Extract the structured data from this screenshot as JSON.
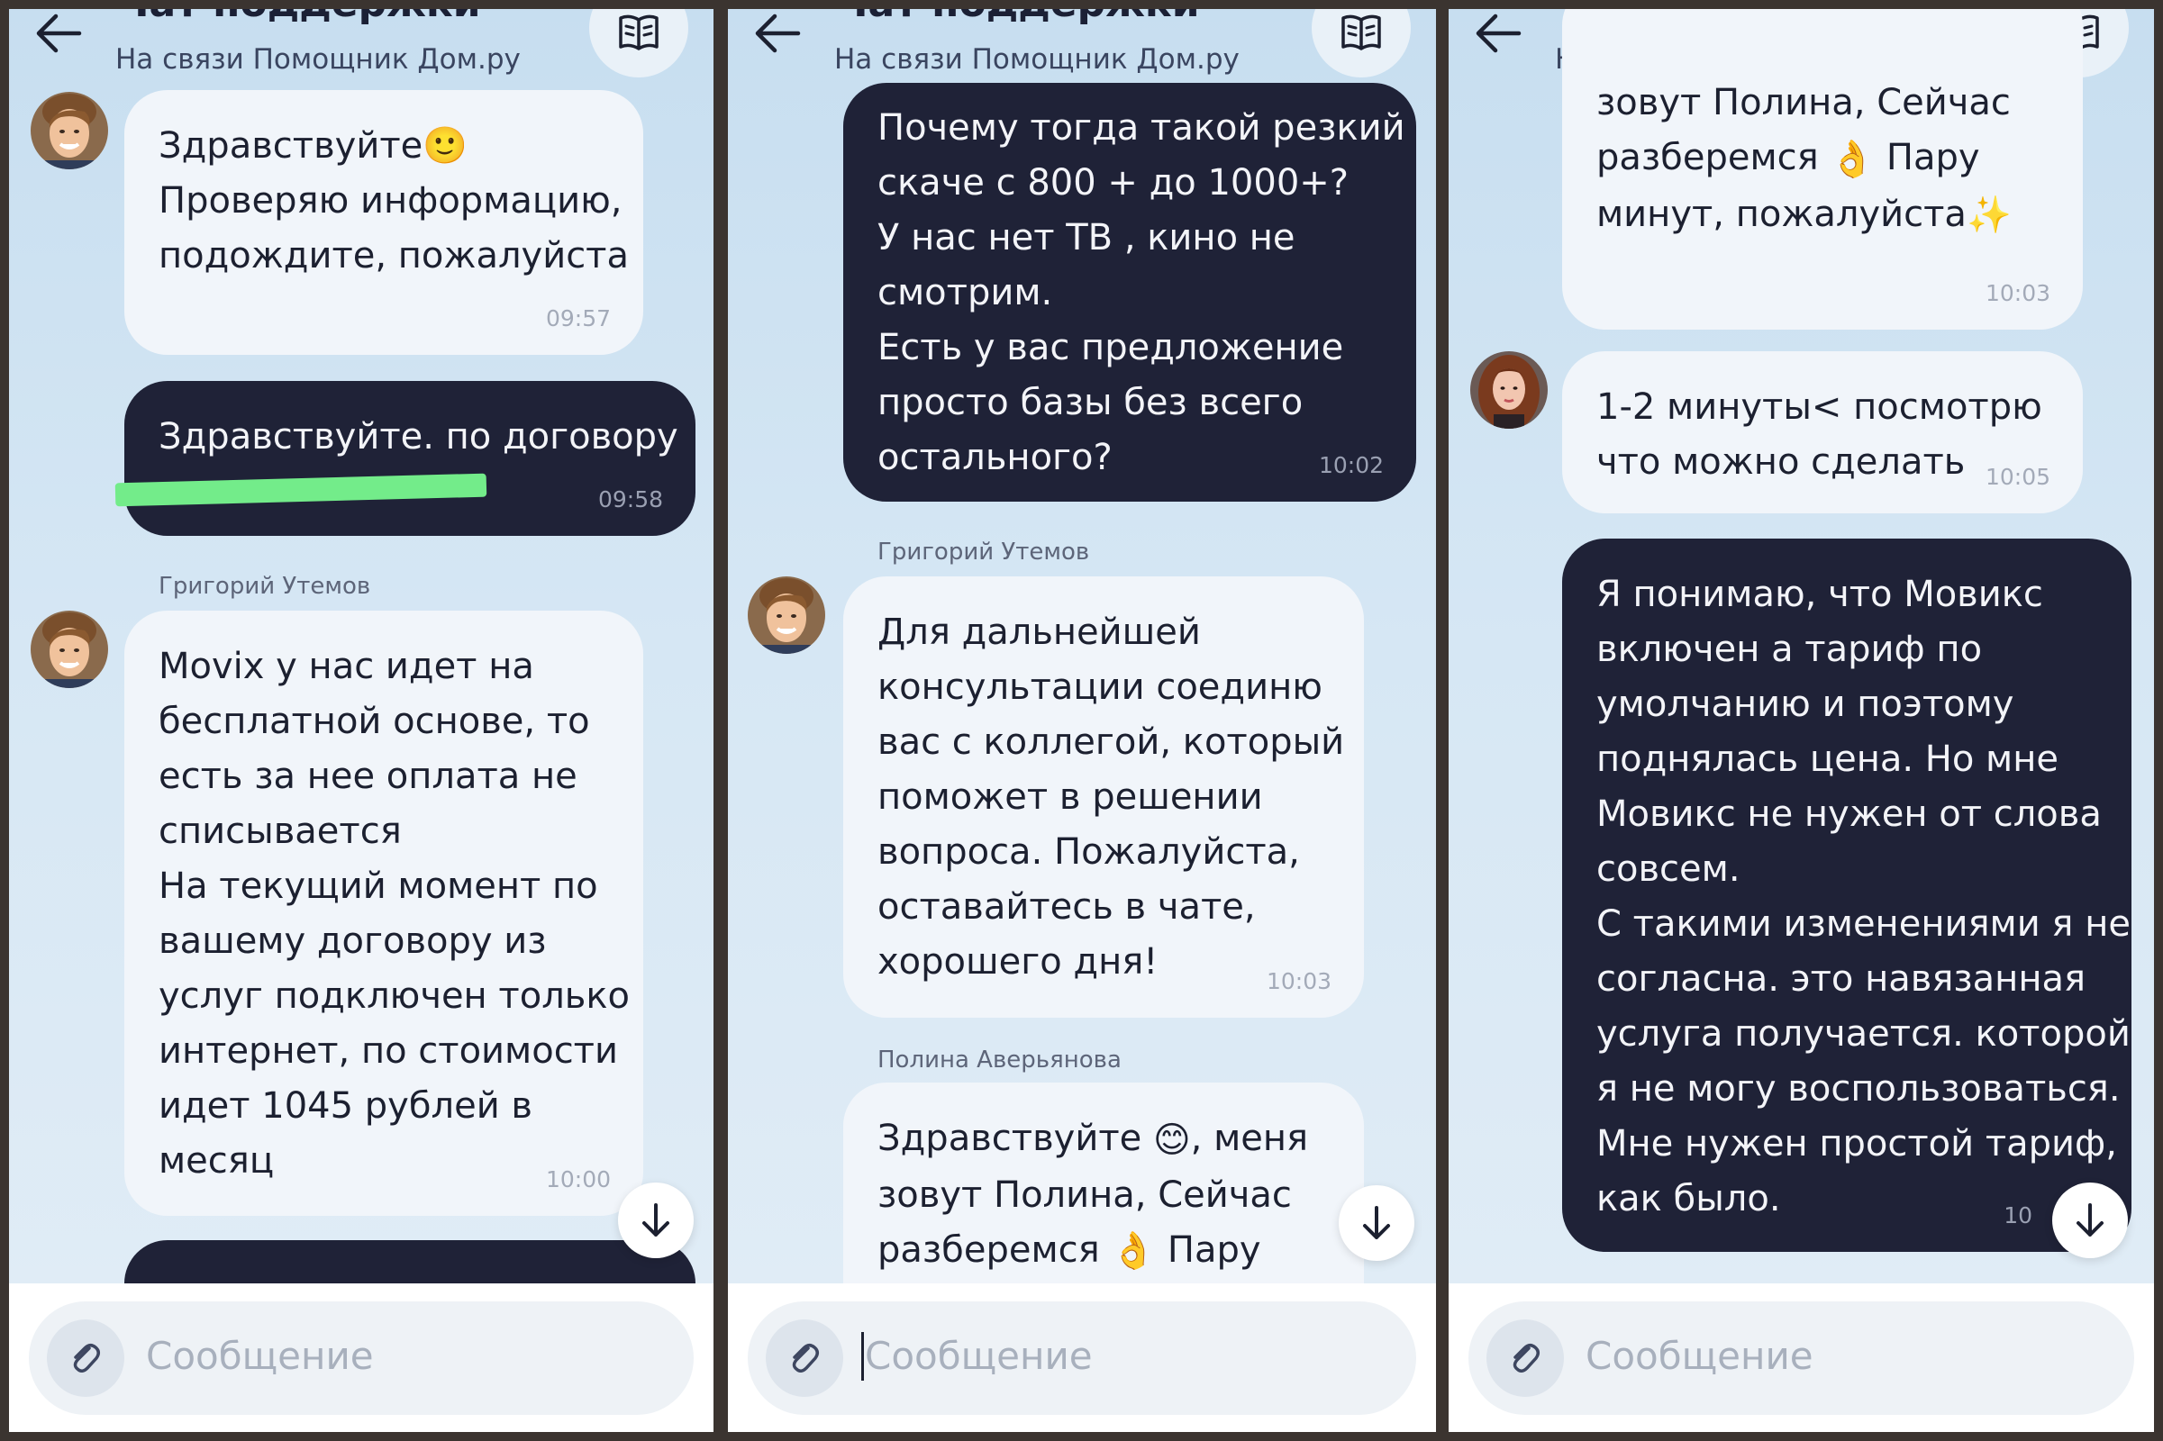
{
  "chat": {
    "title": "Чат поддержки",
    "subtitle": "На связи Помощник Дом.ру",
    "input_placeholder": "Сообщение"
  },
  "colors": {
    "incoming_bubble": "#f1f5fa",
    "outgoing_bubble": "#1f2237",
    "background": "#d6e7f4",
    "redaction_marker": "#73ec8a"
  },
  "icons": {
    "back": "arrow-left-icon",
    "manual": "book-icon",
    "scroll_down": "arrow-down-icon",
    "attach": "paperclip-icon"
  },
  "panel1": {
    "msg1": {
      "line1": "Здравствуйте🙂",
      "line2": "Проверяю информацию,",
      "line3": "подождите, пожалуйста",
      "time": "09:57"
    },
    "msg2": {
      "line1": "Здравствуйте. по договору",
      "time": "09:58"
    },
    "sender": "Григорий Утемов",
    "msg3": {
      "lines": [
        "Movix у нас идет на",
        "бесплатной основе, то",
        "есть за нее оплата не",
        "списывается",
        "На текущий момент по",
        "вашему договору из",
        "услуг подключен только",
        "интернет, по стоимости",
        "идет 1045 рублей в",
        "месяц"
      ],
      "time": "10:00"
    }
  },
  "panel2": {
    "msg1": {
      "lines": [
        "Почему тогда такой резкий",
        "скаче с 800 + до 1000+?",
        "У нас нет ТВ , кино не",
        "смотрим.",
        "Есть у вас предложение",
        "просто базы без всего",
        "остального?"
      ],
      "time": "10:02"
    },
    "sender1": "Григорий Утемов",
    "msg2": {
      "lines": [
        "Для дальнейшей",
        "консультации соединю",
        "вас с коллегой, который",
        "поможет в решении",
        "вопроса. Пожалуйста,",
        "оставайтесь в чате,",
        "хорошего дня!"
      ],
      "time": "10:03"
    },
    "sender2": "Полина Аверьянова",
    "msg3": {
      "line1_text": "Здравствуйте",
      "line1_emoji": "😊",
      "line1_tail": ", меня",
      "line2": "зовут Полина, Сейчас",
      "line3_text": "разберемся",
      "line3_emoji": "👌",
      "line3_tail": " Пару"
    }
  },
  "panel3": {
    "msg1": {
      "line1": "зовут Полина, Сейчас",
      "line2_text": "разберемся",
      "line2_emoji": "👌",
      "line2_tail": " Пару",
      "line3_text": "минут, пожалуйста",
      "line3_emoji": "✨",
      "time": "10:03"
    },
    "msg2": {
      "line1": "1-2 минуты< посмотрю",
      "line2": "что можно сделать",
      "time": "10:05"
    },
    "msg3": {
      "lines": [
        "Я понимаю, что Мовикс",
        "включен а тариф по",
        "умолчанию и поэтому",
        "поднялась цена. Но мне",
        "Мовикс не нужен от слова",
        "совсем.",
        "С такими изменениями я не",
        "согласна. это навязанная",
        "услуга получается. которой",
        "я не могу воспользоваться.",
        "Мне нужен простой тариф,",
        "как было."
      ],
      "time_partial": "10"
    }
  }
}
